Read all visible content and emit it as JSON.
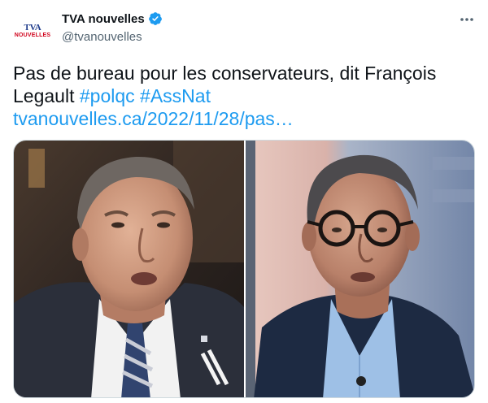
{
  "account": {
    "display_name": "TVA nouvelles",
    "handle": "@tvanouvelles",
    "logo_top": "TVA",
    "logo_bottom": "NOUVELLES",
    "verified_icon": "verified-badge-icon"
  },
  "menu": {
    "icon": "more-options-icon"
  },
  "tweet": {
    "text": "Pas de bureau pour les conservateurs, dit François Legault",
    "hashtag_1": "#polqc",
    "hashtag_2": "#AssNat",
    "link": "tvanouvelles.ca/2022/11/28/pas…"
  },
  "colors": {
    "link": "#1d9bf0",
    "secondary_text": "#536471",
    "brand_blue": "#1d3a8a",
    "brand_red": "#d0021b"
  }
}
